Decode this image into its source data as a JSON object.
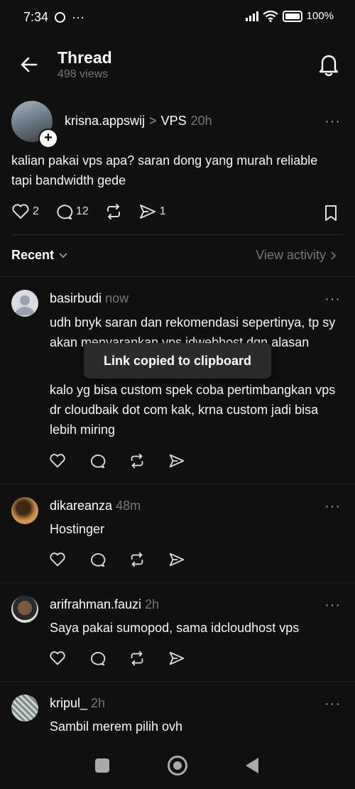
{
  "status": {
    "time": "7:34",
    "whatsapp_icon": "whatsapp-icon",
    "more": "···",
    "battery": "100%"
  },
  "header": {
    "title": "Thread",
    "views": "498 views"
  },
  "op": {
    "username": "krisna.appswij",
    "separator": ">",
    "community": "VPS",
    "time": "20h",
    "more": "···",
    "text": "kalian pakai vps apa? saran dong yang murah reliable tapi bandwidth gede",
    "likes": "2",
    "replies": "12",
    "shares": "1"
  },
  "sort": {
    "label": "Recent",
    "view_activity": "View activity"
  },
  "replies": [
    {
      "username": "basirbudi",
      "time": "now",
      "more": "···",
      "text1": "udh bnyk saran dan rekomendasi sepertinya, tp sy akan menyarankan vps idwebhost dgn alasan ",
      "text2": "kalo yg bisa custom spek coba pertimbangkan vps dr cloudbaik dot com kak, krna custom jadi bisa lebih miring"
    },
    {
      "username": "dikareanza",
      "time": "48m",
      "more": "···",
      "text": "Hostinger"
    },
    {
      "username": "arifrahman.fauzi",
      "time": "2h",
      "more": "···",
      "text": "Saya pakai sumopod, sama idcloudhost vps"
    },
    {
      "username": "kripul_",
      "time": "2h",
      "more": "···",
      "text": "Sambil merem pilih ovh"
    }
  ],
  "toast": {
    "message": "Link copied to clipboard"
  },
  "colors": {
    "background": "#101010",
    "text": "#f3f5f7",
    "muted": "#777777",
    "toast": "#2b2b2b"
  }
}
